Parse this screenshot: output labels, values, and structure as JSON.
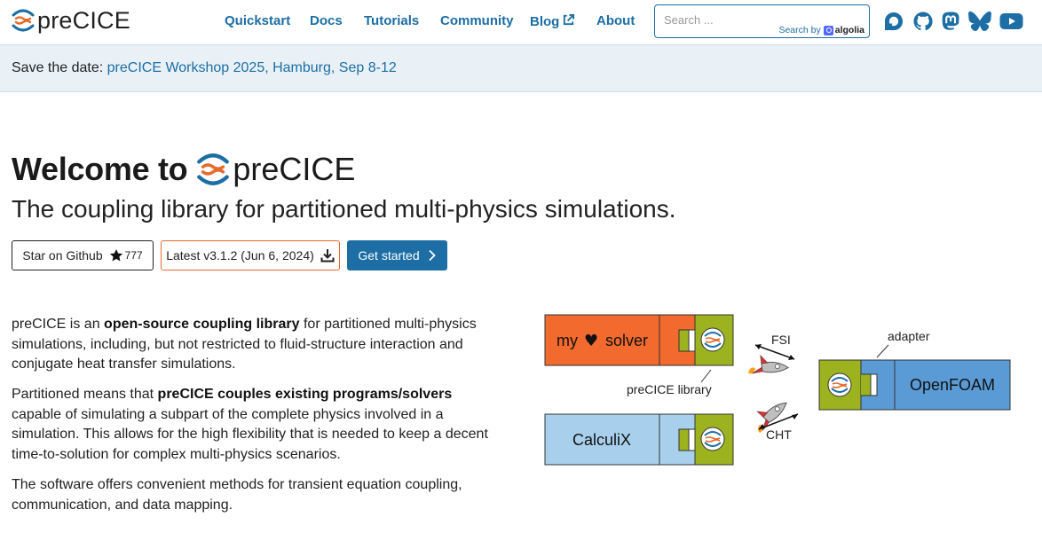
{
  "brand": {
    "name": "preCICE"
  },
  "nav": {
    "items": [
      {
        "label": "Quickstart"
      },
      {
        "label": "Docs"
      },
      {
        "label": "Tutorials"
      },
      {
        "label": "Community"
      },
      {
        "label": "Blog"
      },
      {
        "label": "About"
      }
    ]
  },
  "search": {
    "placeholder": "Search ...",
    "value": "",
    "powered_by": "Search by",
    "provider": "algolia"
  },
  "social": [
    "discourse-icon",
    "github-icon",
    "mastodon-icon",
    "bluesky-icon",
    "youtube-icon"
  ],
  "banner": {
    "prefix": "Save the date:",
    "link": "preCICE Workshop 2025, Hamburg, Sep 8-12"
  },
  "hero": {
    "welcome": "Welcome to",
    "brand": "preCICE",
    "subtitle": "The coupling library for partitioned multi-physics simulations."
  },
  "buttons": {
    "star": "Star on Github",
    "star_count": "777",
    "latest": "Latest v3.1.2 (Jun 6, 2024)",
    "get_started": "Get started"
  },
  "intro": {
    "p1_a": "preCICE is an ",
    "p1_b": "open-source coupling library",
    "p1_c": " for partitioned multi-physics simulations, including, but not restricted to fluid-structure interaction and conjugate heat transfer simulations.",
    "p2_a": "Partitioned means that ",
    "p2_b": "preCICE couples existing programs/solvers",
    "p2_c": " capable of simulating a subpart of the complete physics involved in a simulation. This allows for the high flexibility that is needed to keep a decent time-to-solution for complex multi-physics scenarios.",
    "p3": "The software offers convenient methods for transient equation coupling, communication, and data mapping."
  },
  "diagram": {
    "solver1_a": "my",
    "solver1_b": "solver",
    "solver2": "CalculiX",
    "solver3": "OpenFOAM",
    "lib_label": "preCICE library",
    "adapter_label": "adapter",
    "fsi": "FSI",
    "cht": "CHT"
  },
  "colors": {
    "accent": "#1c6ea4",
    "banner_bg": "#e9f1f7",
    "orange": "#f26a2e",
    "olive": "#9cb31f",
    "light_blue": "#a8d0ec",
    "blue": "#5b9bd5"
  }
}
